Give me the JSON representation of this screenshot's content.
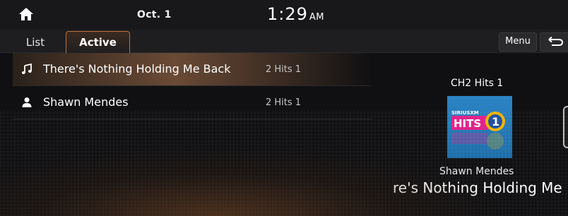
{
  "status": {
    "date": "Oct. 1",
    "time": "1:29",
    "ampm": "AM",
    "home_icon": "home-icon"
  },
  "tabs": [
    {
      "label": "List",
      "active": false
    },
    {
      "label": "Active",
      "active": true
    }
  ],
  "toolbar": {
    "menu_label": "Menu",
    "back_icon": "back-arrow-icon"
  },
  "list": [
    {
      "icon": "music-note-icon",
      "title": "There's Nothing Holding Me Back",
      "channel": "2  Hits 1",
      "selected": true
    },
    {
      "icon": "person-icon",
      "title": "Shawn Mendes",
      "channel": "2  Hits 1",
      "selected": false
    }
  ],
  "now_playing": {
    "channel": "CH2 Hits 1",
    "artist": "Shawn Mendes",
    "title_visible": "re's Nothing Holding Me",
    "album_art": {
      "logo_text": "HITS",
      "number": "1",
      "brand": "SIRIUSXM"
    }
  },
  "colors": {
    "accent": "#c0713a",
    "selected_row": "#6a4a35",
    "background": "#101012",
    "album_bg": "#2c84c5",
    "logo_magenta": "#e0218a"
  }
}
